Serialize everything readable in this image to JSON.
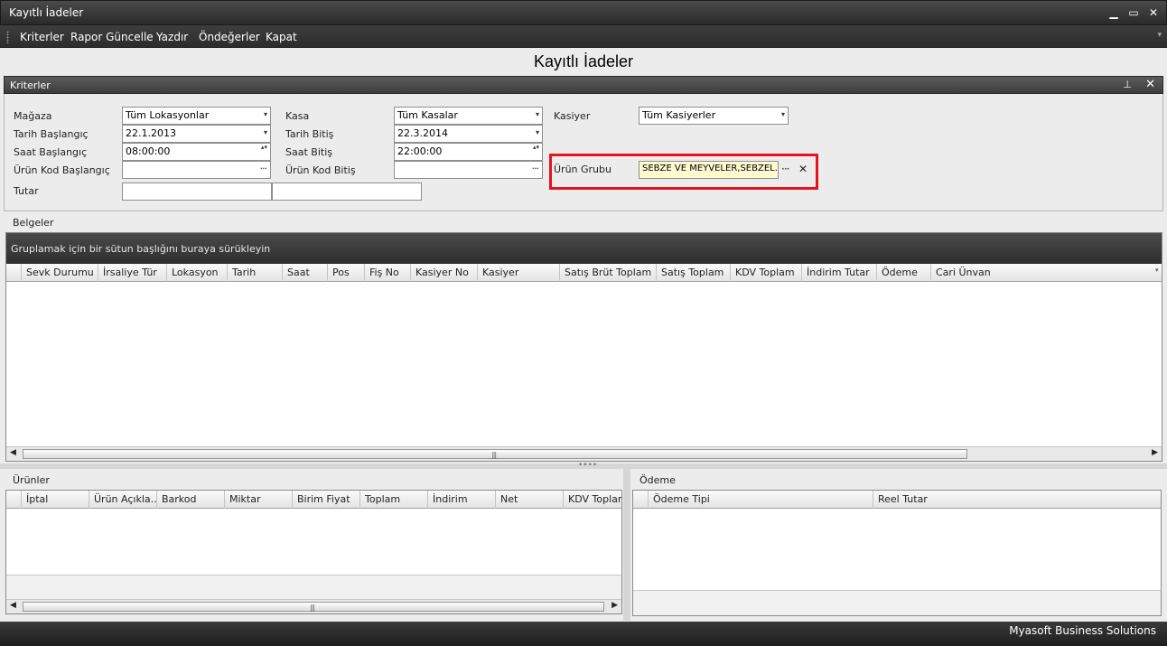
{
  "window": {
    "title": "Kayıtlı İadeler",
    "minimize": "▁",
    "maximize": "▭",
    "close": "✕"
  },
  "menu": {
    "items": [
      "Kriterler",
      "Rapor Güncelle",
      "Yazdır",
      "Öndeğerler",
      "Kapat"
    ],
    "overflow": "▾"
  },
  "page_title": "Kayıtlı İadeler",
  "criteria_panel": {
    "title": "Kriterler",
    "pin_glyph": "⊥",
    "close_glyph": "✕",
    "magaza": {
      "label": "Mağaza",
      "value": "Tüm Lokasyonlar"
    },
    "tarih_baslangic": {
      "label": "Tarih Başlangıç",
      "value": "22.1.2013"
    },
    "saat_baslangic": {
      "label": "Saat Başlangıç",
      "value": "08:00:00"
    },
    "urun_kod_baslangic": {
      "label": "Ürün Kod Başlangıç",
      "value": ""
    },
    "tutar": {
      "label": "Tutar",
      "min": "",
      "max": ""
    },
    "kasa": {
      "label": "Kasa",
      "value": "Tüm Kasalar"
    },
    "tarih_bitis": {
      "label": "Tarih Bitiş",
      "value": "22.3.2014"
    },
    "saat_bitis": {
      "label": "Saat Bitiş",
      "value": "22:00:00"
    },
    "urun_kod_bitis": {
      "label": "Ürün Kod Bitiş",
      "value": ""
    },
    "kasiyer": {
      "label": "Kasiyer",
      "value": "Tüm Kasiyerler"
    },
    "urun_grubu": {
      "label": "Ürün Grubu",
      "value": "SEBZE VE MEYVELER,SEBZEL..."
    },
    "dropdown_glyph": "▾",
    "dots_glyph": "···",
    "spin_glyph": "▴▾",
    "clear_glyph": "✕"
  },
  "belgeler": {
    "title": "Belgeler",
    "group_hint": "Gruplamak için bir sütun başlığını buraya sürükleyin",
    "columns": [
      "Sevk Durumu",
      "İrsaliye Tür",
      "Lokasyon",
      "Tarih",
      "Saat",
      "Pos",
      "Fiş No",
      "Kasiyer No",
      "Kasiyer",
      "Satış Brüt Toplam",
      "Satış Toplam",
      "KDV Toplam",
      "İndirim Tutar",
      "Ödeme",
      "Cari Ünvan"
    ],
    "more_glyph": "▾"
  },
  "urunler": {
    "title": "Ürünler",
    "columns": [
      "İptal",
      "Ürün Açıkla...",
      "Barkod",
      "Miktar",
      "Birim Fiyat",
      "Toplam",
      "İndirim",
      "Net",
      "KDV Toplam"
    ]
  },
  "odeme": {
    "title": "Ödeme",
    "columns": [
      "Ödeme Tipi",
      "Reel Tutar"
    ]
  },
  "scroll": {
    "left": "◀",
    "right": "▶",
    "grip": "|||"
  },
  "splitter": {
    "grip": "••••"
  },
  "status": {
    "company": "Myasoft Business Solutions"
  }
}
